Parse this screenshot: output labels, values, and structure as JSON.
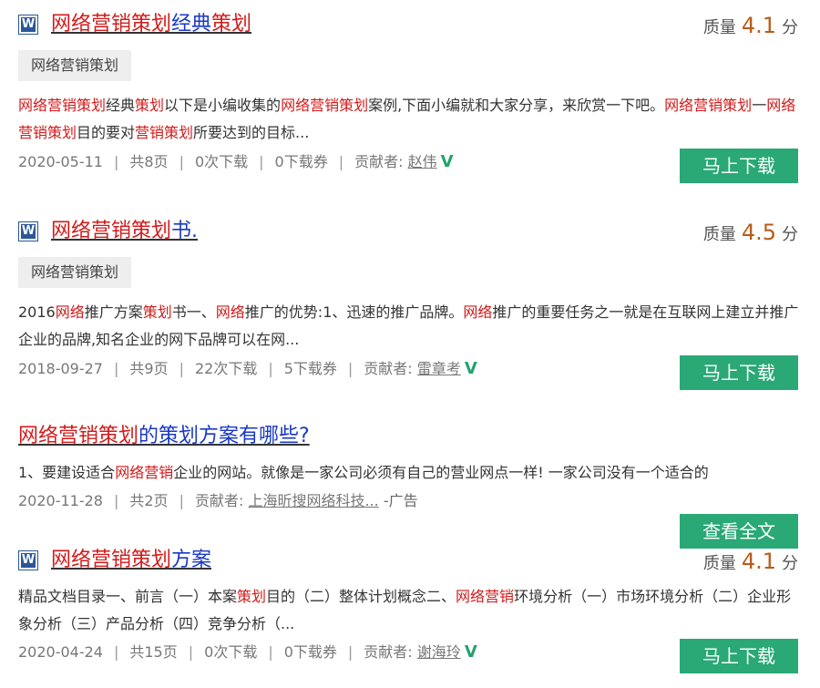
{
  "results": [
    {
      "title_parts": [
        {
          "text": "网络营销策划",
          "hl": true
        },
        {
          "text": "经典",
          "hl": false
        },
        {
          "text": "策划",
          "hl": true
        }
      ],
      "quality_label": "质量",
      "quality_score": "4.1",
      "quality_unit": "分",
      "tag": "网络营销策划",
      "desc_parts": [
        {
          "text": "网络营销策划",
          "hl": true
        },
        {
          "text": "经典",
          "hl": false
        },
        {
          "text": "策划",
          "hl": true
        },
        {
          "text": "以下是小编收集的",
          "hl": false
        },
        {
          "text": "网络营销策划",
          "hl": true
        },
        {
          "text": "案例,下面小编就和大家分享，来欣赏一下吧。",
          "hl": false
        },
        {
          "text": "网络营销策划",
          "hl": true
        },
        {
          "text": "一",
          "hl": false
        },
        {
          "text": "网络营销策划",
          "hl": true
        },
        {
          "text": "目的要对",
          "hl": false
        },
        {
          "text": "营销策划",
          "hl": true
        },
        {
          "text": "所要达到的目标...",
          "hl": false
        }
      ],
      "date": "2020-05-11",
      "pages": "共8页",
      "downloads": "0次下载",
      "coupons": "0下载券",
      "contributor_label": "贡献者:",
      "author": "赵伟",
      "button": "马上下载"
    },
    {
      "title_parts": [
        {
          "text": "网络营销策划",
          "hl": true
        },
        {
          "text": "书.",
          "hl": false
        }
      ],
      "quality_label": "质量",
      "quality_score": "4.5",
      "quality_unit": "分",
      "tag": "网络营销策划",
      "desc_parts": [
        {
          "text": "2016",
          "hl": false
        },
        {
          "text": "网络",
          "hl": true
        },
        {
          "text": "推广方案",
          "hl": false
        },
        {
          "text": "策划",
          "hl": true
        },
        {
          "text": "书一、",
          "hl": false
        },
        {
          "text": "网络",
          "hl": true
        },
        {
          "text": "推广的优势:1、迅速的推广品牌。",
          "hl": false
        },
        {
          "text": "网络",
          "hl": true
        },
        {
          "text": "推广的重要任务之一就是在互联网上建立并推广企业的品牌,知名企业的网下品牌可以在网...",
          "hl": false
        }
      ],
      "date": "2018-09-27",
      "pages": "共9页",
      "downloads": "22次下载",
      "coupons": "5下载券",
      "contributor_label": "贡献者:",
      "author": "雷章考",
      "button": "马上下载"
    },
    {
      "title_parts": [
        {
          "text": "网络营销策划",
          "hl": true
        },
        {
          "text": "的策划方案有哪些?",
          "hl": false
        }
      ],
      "desc_parts": [
        {
          "text": "1、要建设适合",
          "hl": false
        },
        {
          "text": "网络营销",
          "hl": true
        },
        {
          "text": "企业的网站。就像是一家公司必须有自己的营业网点一样! 一家公司没有一个适合的",
          "hl": false
        }
      ],
      "date": "2020-11-28",
      "pages": "共2页",
      "contributor_label": "贡献者:",
      "author": "上海昕搜网络科技...",
      "ad_label": "-广告",
      "button": "查看全文"
    },
    {
      "title_parts": [
        {
          "text": "网络营销策划",
          "hl": true
        },
        {
          "text": "方案",
          "hl": false
        }
      ],
      "quality_label": "质量",
      "quality_score": "4.1",
      "quality_unit": "分",
      "desc_parts": [
        {
          "text": "精品文档目录一、前言（一）本案",
          "hl": false
        },
        {
          "text": "策划",
          "hl": true
        },
        {
          "text": "目的（二）整体计划概念二、",
          "hl": false
        },
        {
          "text": "网络营销",
          "hl": true
        },
        {
          "text": "环境分析（一）市场环境分析（二）企业形象分析（三）产品分析（四）竞争分析（...",
          "hl": false
        }
      ],
      "date": "2020-04-24",
      "pages": "共15页",
      "downloads": "0次下载",
      "coupons": "0下载券",
      "contributor_label": "贡献者:",
      "author": "谢海玲",
      "button": "马上下载"
    }
  ],
  "colors": {
    "highlight": "#d21a1a",
    "link": "#1a39c4",
    "button": "#2aa876",
    "score": "#b85c1a"
  },
  "icons": {
    "doc": "word-doc-icon",
    "verified": "verified-v-icon"
  }
}
